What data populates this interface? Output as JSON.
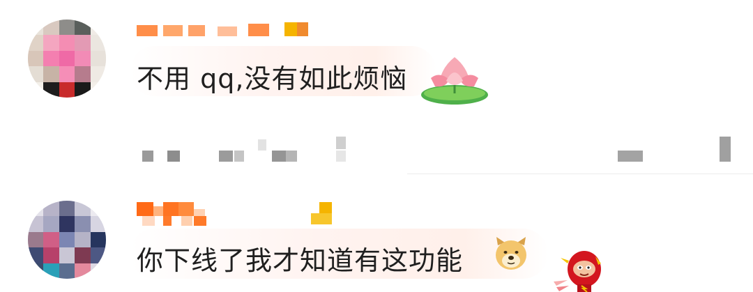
{
  "comments": [
    {
      "text": "不用 qq,没有如此烦恼",
      "emoji": "lotus-sticker-icon"
    },
    {
      "text": "你下线了我才知道有这功能",
      "emoji": "doge-face-icon",
      "sticker": "red-hero-sticker-icon"
    }
  ],
  "colors": {
    "username": "#ff7a29",
    "badge": "#f5b400",
    "comment_text": "#1f1f1f",
    "bubble_tint": "#fff1ec"
  }
}
